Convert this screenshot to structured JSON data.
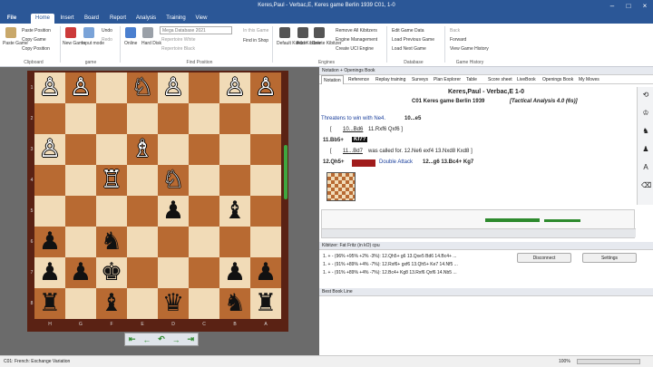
{
  "window": {
    "title": "Keres,Paul - Verbac,E, Keres game Berlin 1939  C01, 1-0"
  },
  "menu": {
    "file": "File",
    "tabs": [
      "Home",
      "Insert",
      "Board",
      "Report",
      "Analysis",
      "Training",
      "View"
    ]
  },
  "ribbon": {
    "paste_game": "Paste Game",
    "paste_position": "Paste Position",
    "copy_game": "Copy Game",
    "copy_position": "Copy Position",
    "new_game": "New Game",
    "input_mode": "Input mode",
    "undo": "Undo",
    "redo": "Redo",
    "online": "Online",
    "hard_disk": "Hard Disk",
    "database_select": "Mega Database 2021",
    "rep_white": "Repertoire White",
    "rep_black": "Repertoire Black",
    "in_this_game": "In this Game",
    "find_in_shop": "Find in Shop",
    "default_kibitzer": "Default Kibitzer",
    "add_kibitzer": "Add Kibitzer",
    "delete_kibitzer": "Delete Kibitzer",
    "remove_all_kibitzers": "Remove All Kibitzers",
    "engine_management": "Engine Management",
    "create_uci": "Create UCI Engine",
    "edit_game_data": "Edit Game Data",
    "load_previous": "Load Previous Game",
    "load_next": "Load Next Game",
    "back": "Back",
    "forward": "Forward",
    "view_history": "View Game History",
    "groups": {
      "clipboard": "Clipboard",
      "game": "game",
      "find_position": "Find Position",
      "engines": "Engines",
      "database": "Database",
      "game_history": "Game History"
    }
  },
  "board": {
    "ranks": [
      "1",
      "2",
      "3",
      "4",
      "5",
      "6",
      "7",
      "8"
    ],
    "files": [
      "H",
      "G",
      "F",
      "E",
      "D",
      "C",
      "B",
      "A"
    ],
    "squares": [
      [
        "",
        "♔",
        "",
        "",
        "♕",
        "",
        "",
        ""
      ],
      [
        "♙",
        "♙",
        "",
        "♘",
        "♙",
        "",
        "♙",
        "♙"
      ],
      [
        "",
        "",
        "",
        "",
        "",
        "",
        "",
        ""
      ],
      [
        "♙",
        "",
        "",
        "♗",
        "",
        "",
        "",
        ""
      ],
      [
        "",
        "",
        "♖",
        "",
        "♘",
        "",
        "",
        ""
      ],
      [
        "",
        "",
        "",
        "",
        "♟",
        "",
        "♝",
        ""
      ],
      [
        "♟",
        "",
        "♞",
        "",
        "",
        "",
        "",
        ""
      ],
      [
        "♟",
        "♟",
        "♚",
        "",
        "",
        "",
        "♟",
        "♟"
      ],
      [
        "♜",
        "",
        "♝",
        "",
        "♛",
        "",
        "♞",
        "♜"
      ]
    ]
  },
  "panel": {
    "header": "Notation + Openings Book",
    "tabs": [
      "Notation",
      "Reference",
      "Replay training",
      "Surveys",
      "Plan Explorer",
      "Table",
      "Score sheet",
      "LiveBook",
      "Openings Book",
      "My Moves"
    ],
    "game_title": "Keres,Paul - Verbac,E  1-0",
    "game_sub": "C01 Keres game Berlin 1939",
    "game_sub_italic": "[Tactical Analysis 4.0 (6s)]",
    "line1a": "Threatens to win with Ne4.",
    "line1b": "10...e5",
    "line2": "[ ",
    "line2b": "10...Bd6",
    "line2c": " 11.Rxf6  Qxf6 ]",
    "line3a": "11.Bb5+",
    "line3b": "Kf7?",
    "line4a": "[ ",
    "line4b": "11...Bd7",
    "line4c": " was called for.  12.Ne6  exf4  13.Nxd8  Kxd8 ]",
    "line5a": "12.Qh5+",
    "line5b": "Double Attack",
    "line5c": "12...g6  13.Bc4+  Kg7"
  },
  "kibitzer": {
    "header": "Kibitzer: Fat Fritz (in kO) cpu",
    "lines": [
      "1. + - (96% +95% +2% -3%): 12.Qh5+ g6 13.Qxe5 Bd6 14.Bc4+ ...",
      "1. + - (91% +89% +4% -7%): 12.Rxf6+ gxf6 13.Qh5+ Ke7 14.Nf5 ...",
      "1. + - (91% +89% +4% -7%): 12.Bc4+ Kg8 13.Rxf6 Qxf6 14.Nb5 ..."
    ],
    "disconnect": "Disconnect",
    "settings": "Settings"
  },
  "book": {
    "header": "Best Book Line"
  },
  "status": {
    "opening": "C01: French: Exchange Variation",
    "zoom": "100%"
  },
  "colors": {
    "accent": "#2b5797",
    "light_square": "#f1dbb7",
    "dark_square": "#b86a32"
  }
}
